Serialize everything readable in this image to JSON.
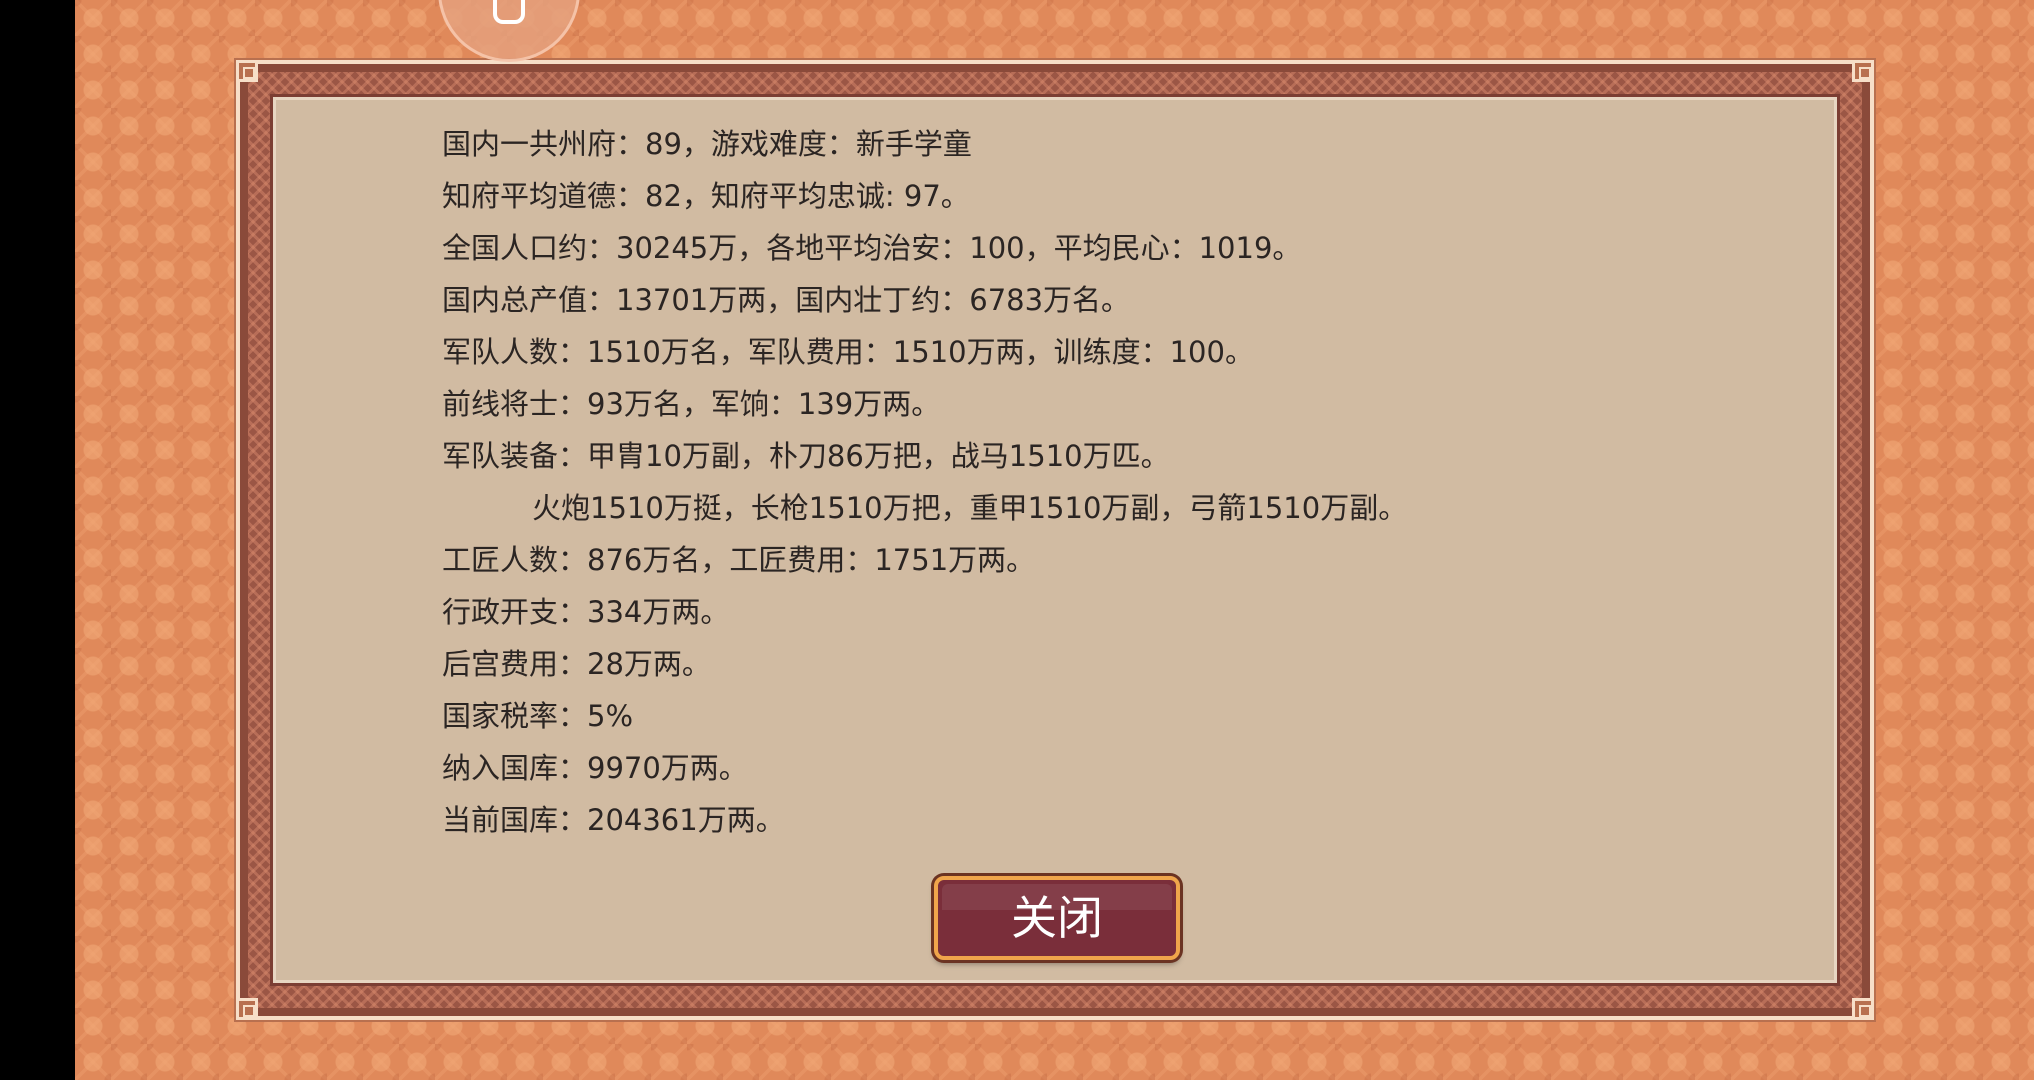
{
  "stats": {
    "lines": [
      "国内一共州府：89，游戏难度：新手学童",
      "知府平均道德：82，知府平均忠诚: 97。",
      "全国人口约：30245万，各地平均治安：100，平均民心：1019。",
      "国内总产值：13701万两，国内壮丁约：6783万名。",
      "军队人数：1510万名，军队费用：1510万两，训练度：100。",
      "前线将士：93万名，军饷：139万两。",
      "军队装备：甲胄10万副，朴刀86万把，战马1510万匹。",
      "火炮1510万挺，长枪1510万把，重甲1510万副，弓箭1510万副。",
      "工匠人数：876万名，工匠费用：1751万两。",
      "行政开支：334万两。",
      "后宫费用：28万两。",
      "国家税率：5%",
      "纳入国库：9970万两。",
      "当前国库：204361万两。"
    ]
  },
  "buttons": {
    "close_label": "关闭"
  },
  "icons": {
    "floating_button": "pocket-icon"
  },
  "colors": {
    "background": "#e0895a",
    "panel": "#d1bba2",
    "frame": "#8a4a3a",
    "button": "#7a2e3a",
    "button_border": "#f0a54b",
    "text": "#2b2523"
  }
}
